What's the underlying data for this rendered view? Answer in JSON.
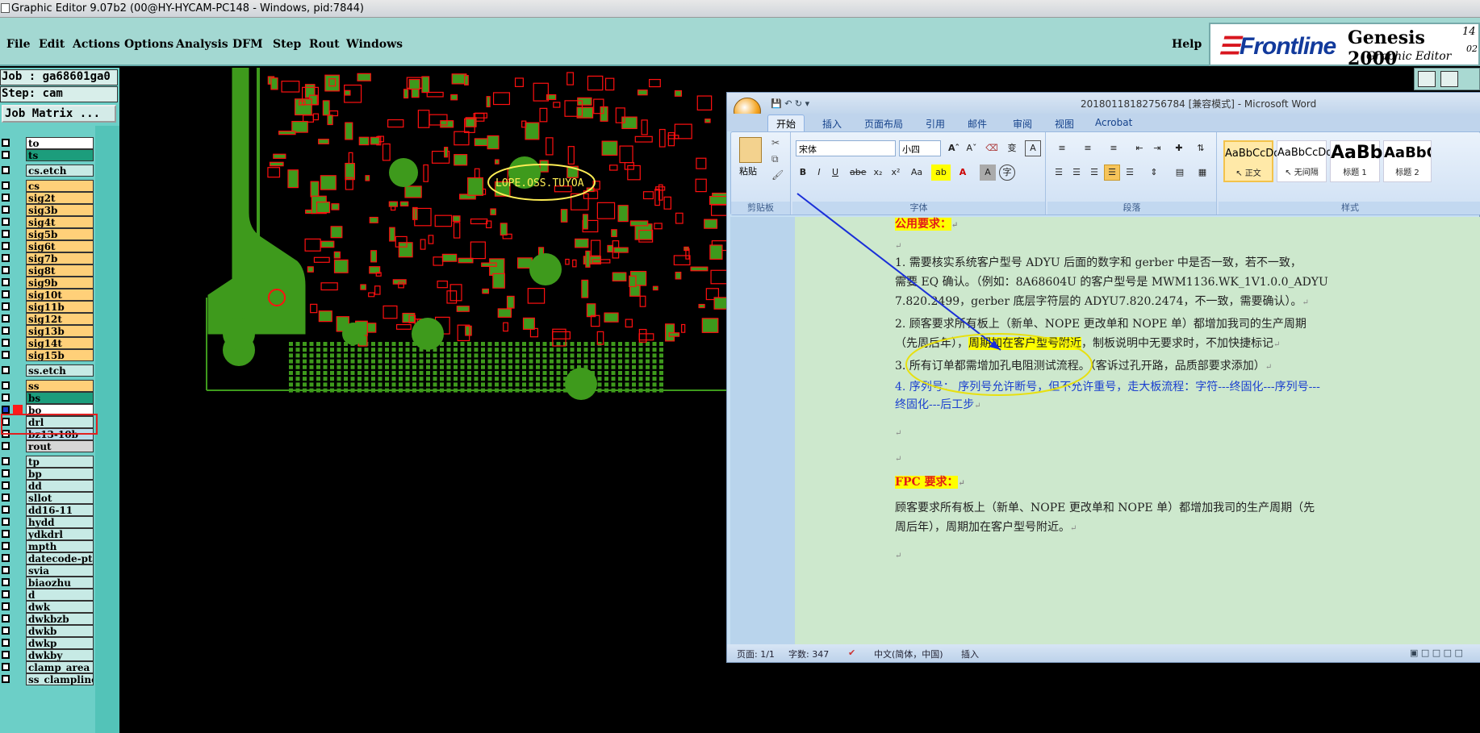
{
  "window": {
    "title": "Graphic Editor 9.07b2 (00@HY-HYCAM-PC148 - Windows, pid:7844)"
  },
  "menu": {
    "items": [
      "File",
      "Edit",
      "Actions",
      "Options",
      "Analysis",
      "DFM",
      "Step",
      "Rout",
      "Windows"
    ],
    "help": "Help"
  },
  "logo": {
    "brand_a": "☰",
    "brand": "Frontline",
    "product": "Genesis 2000",
    "subtitle": "Graphic Editor",
    "ver1": "14",
    "ver2": "02"
  },
  "job": {
    "job_label": "Job : ga68601ga0",
    "step_label": "Step: cam",
    "matrix_button": "Job Matrix ..."
  },
  "layers": [
    {
      "name": "to",
      "color": "c-white",
      "icon": "edit-icon"
    },
    {
      "name": "ts",
      "color": "c-green"
    },
    {
      "name": "cs.etch",
      "color": "c-teal",
      "gap": true
    },
    {
      "name": "cs",
      "color": "c-orange",
      "gap": true
    },
    {
      "name": "sig2t",
      "color": "c-orange"
    },
    {
      "name": "sig3b",
      "color": "c-orange"
    },
    {
      "name": "sig4t",
      "color": "c-orange"
    },
    {
      "name": "sig5b",
      "color": "c-orange"
    },
    {
      "name": "sig6t",
      "color": "c-orange"
    },
    {
      "name": "sig7b",
      "color": "c-orange"
    },
    {
      "name": "sig8t",
      "color": "c-orange"
    },
    {
      "name": "sig9b",
      "color": "c-orange"
    },
    {
      "name": "sig10t",
      "color": "c-orange"
    },
    {
      "name": "sig11b",
      "color": "c-orange"
    },
    {
      "name": "sig12t",
      "color": "c-orange"
    },
    {
      "name": "sig13b",
      "color": "c-orange"
    },
    {
      "name": "sig14t",
      "color": "c-orange"
    },
    {
      "name": "sig15b",
      "color": "c-orange"
    },
    {
      "name": "ss.etch",
      "color": "c-teal",
      "gap": true
    },
    {
      "name": "ss",
      "color": "c-orange",
      "gap": true
    },
    {
      "name": "bs",
      "color": "c-green"
    },
    {
      "name": "bo",
      "color": "c-white",
      "active": true
    },
    {
      "name": "drl",
      "color": "c-teal"
    },
    {
      "name": "bz13-10b",
      "color": "c-blue"
    },
    {
      "name": "rout",
      "color": "c-gray"
    },
    {
      "name": "tp",
      "color": "c-teal",
      "gap": true
    },
    {
      "name": "bp",
      "color": "c-teal"
    },
    {
      "name": "dd",
      "color": "c-teal"
    },
    {
      "name": "sllot",
      "color": "c-teal"
    },
    {
      "name": "dd16-11",
      "color": "c-teal"
    },
    {
      "name": "hydd",
      "color": "c-teal"
    },
    {
      "name": "ydkdrl",
      "color": "c-teal"
    },
    {
      "name": "mpth",
      "color": "c-teal"
    },
    {
      "name": "datecode-ptc",
      "color": "c-teal"
    },
    {
      "name": "svia",
      "color": "c-teal"
    },
    {
      "name": "biaozhu",
      "color": "c-teal"
    },
    {
      "name": "d",
      "color": "c-teal"
    },
    {
      "name": "dwk",
      "color": "c-teal"
    },
    {
      "name": "dwkbzb",
      "color": "c-teal"
    },
    {
      "name": "dwkb",
      "color": "c-teal"
    },
    {
      "name": "dwkp",
      "color": "c-teal"
    },
    {
      "name": "dwkby",
      "color": "c-teal"
    },
    {
      "name": "clamp_area",
      "color": "c-teal"
    },
    {
      "name": "ss_clampline",
      "color": "c-teal"
    }
  ],
  "board": {
    "annotation": "LOPE.OSS.TUYOA"
  },
  "word": {
    "title": "20180118182756784 [兼容模式] - Microsoft Word",
    "tabs": [
      "开始",
      "插入",
      "页面布局",
      "引用",
      "邮件",
      "审阅",
      "视图",
      "Acrobat"
    ],
    "font_name": "宋体",
    "font_size": "小四",
    "paste": "粘贴",
    "groups": {
      "clipboard": "剪贴板",
      "font": "字体",
      "paragraph": "段落",
      "styles": "样式"
    },
    "styles": [
      {
        "preview": "AaBbCcDd",
        "label": "↖ 正文"
      },
      {
        "preview": "AaBbCcDd",
        "label": "↖ 无间隔"
      },
      {
        "preview": "AaBb",
        "label": "标题 1"
      },
      {
        "preview": "AaBbC",
        "label": "标题 2"
      }
    ],
    "doc": {
      "h1": "公用要求：",
      "p1a": "1.  需要核实系统客户型号 ADYU 后面的数字和 gerber 中是否一致，若不一致，",
      "p1b": "需要 EQ 确认。（例如：8A68604U 的客户型号是 MWM1136.WK_1V1.0.0_ADYU",
      "p1c": "7.820.2499，gerber 底层字符层的 ADYU7.820.2474，不一致，需要确认）。",
      "p2a": "2. 顾客要求所有板上（新单、NOPE 更改单和 NOPE 单）都增加我司的生产周期",
      "p2b": "（先周后年），",
      "p2hl": "周期加在客户型号附近",
      "p2c": "，制板说明中无要求时，不加快捷标记",
      "p3": "3. 所有订单都需增加孔电阻测试流程。（客诉过孔开路，品质部要求添加）",
      "p4a": "4. 序列号：  序列号允许断号，但不允许重号，走大板流程：字符---终固化---序列号---",
      "p4b": "终固化---后工步",
      "h2": "FPC 要求：",
      "p5a": "顾客要求所有板上（新单、NOPE 更改单和 NOPE 单）都增加我司的生产周期（先",
      "p5b": "周后年），周期加在客户型号附近。",
      "pm": "↵"
    },
    "status": {
      "page": "页面: 1/1",
      "words": "字数: 347",
      "lang": "中文(简体，中国)",
      "mode": "插入"
    }
  },
  "colors": {
    "board_green": "#3e9a1c",
    "board_red": "#ff1010",
    "panel": "#6ccfc7",
    "menubar": "#a3d8d2"
  }
}
